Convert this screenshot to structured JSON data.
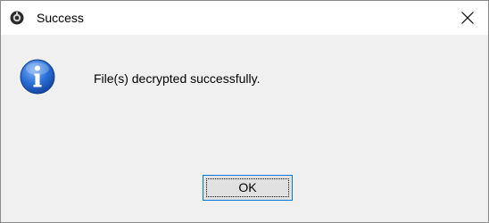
{
  "dialog": {
    "title": "Success",
    "message": "File(s) decrypted successfully.",
    "ok_label": "OK",
    "icons": {
      "app": "app-logo-icon",
      "close": "close-icon",
      "info": "information-icon"
    },
    "colors": {
      "focus_border": "#0078d7",
      "info_blue": "#1f5fc9"
    }
  }
}
